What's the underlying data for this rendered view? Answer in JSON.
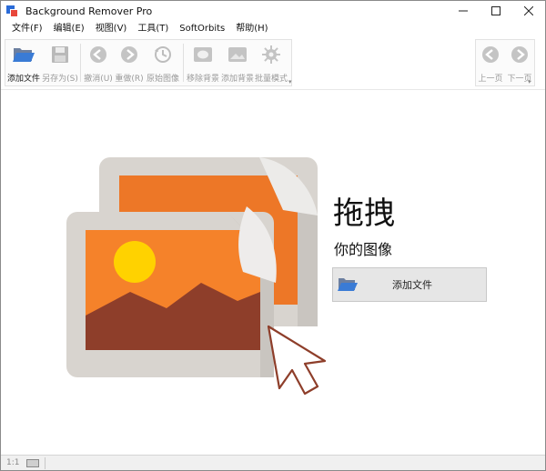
{
  "window": {
    "title": "Background Remover Pro"
  },
  "menu": {
    "items": [
      {
        "label": "文件(F)"
      },
      {
        "label": "编辑(E)"
      },
      {
        "label": "视图(V)"
      },
      {
        "label": "工具(T)"
      },
      {
        "label": "SoftOrbits"
      },
      {
        "label": "帮助(H)"
      }
    ]
  },
  "toolbar": {
    "add_file": "添加文件",
    "save_as": "另存为(S)",
    "undo": "撤消(U)",
    "redo": "重做(R)",
    "original": "原始图像",
    "remove_bg": "移除背景",
    "add_bg": "添加背景",
    "batch": "批量模式",
    "prev": "上一页",
    "next": "下一页"
  },
  "dropzone": {
    "title": "拖拽",
    "subtitle": "你的图像",
    "button_label": "添加文件"
  },
  "status": {
    "zoom": "1:1"
  },
  "colors": {
    "accent": "#f5822a",
    "photo_orange": "#f5822a",
    "sun": "#ffd200",
    "mountain": "#8e3e2a",
    "toolbar_icon_blue": "#3a7bd5",
    "disabled_gray": "#b9b9b9"
  }
}
